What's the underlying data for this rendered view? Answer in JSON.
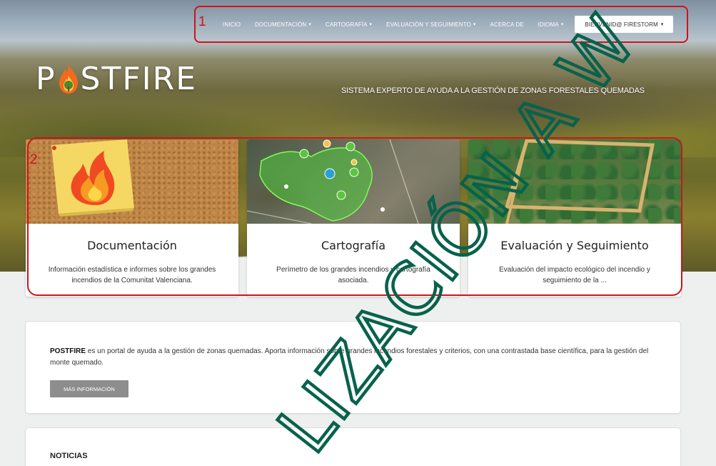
{
  "nav": {
    "items": [
      {
        "label": "INICIO",
        "dropdown": false
      },
      {
        "label": "DOCUMENTACIÓN",
        "dropdown": true
      },
      {
        "label": "CARTOGRAFÍA",
        "dropdown": true
      },
      {
        "label": "EVALUACIÓN Y SEGUIMIENTO",
        "dropdown": true
      },
      {
        "label": "ACERCA DE",
        "dropdown": false
      },
      {
        "label": "IDIOMA",
        "dropdown": true
      }
    ],
    "user_button": "BIENVENID@ FIRESTORM",
    "caret": "▾"
  },
  "annotations": {
    "one": "1",
    "two": "2"
  },
  "logo": {
    "text_start": "P",
    "text_end": "STFIRE"
  },
  "tagline": "SISTEMA EXPERTO DE AYUDA A LA GESTIÓN DE ZONAS FORESTALES QUEMADAS",
  "cards": [
    {
      "title": "Documentación",
      "description": "Información estadística e informes sobre los grandes incendios de la Comunitat Valenciana."
    },
    {
      "title": "Cartografía",
      "description": "Perímetro de los grandes incendios y cartografía asociada."
    },
    {
      "title": "Evaluación y Seguimiento",
      "description": "Evaluación del impacto ecológico del incendio y seguimiento de la ..."
    }
  ],
  "intro": {
    "brand": "POSTFIRE",
    "text": " es un portal de ayuda a la gestión de zonas quemadas. Aporta información sobre grandes incendios forestales y criterios, con una contrastada base científica, para la gestión del monte quemado.",
    "button": "MÁS INFORMACIÓN"
  },
  "news": {
    "title": "NOTICIAS"
  },
  "watermark": "LIZACIÓN A W",
  "colors": {
    "annotation": "#d0131b",
    "watermark": "#08624b",
    "flame": "#f26b1d"
  }
}
